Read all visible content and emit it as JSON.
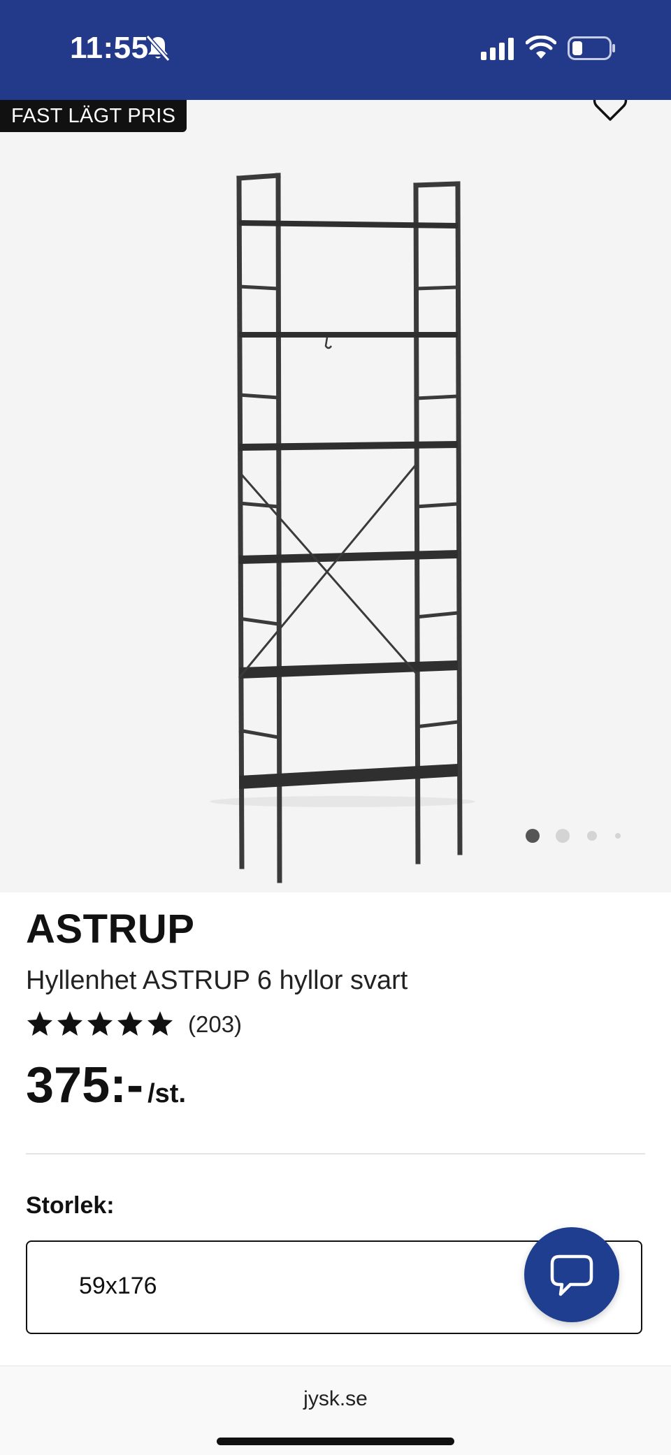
{
  "status_bar": {
    "time": "11:55",
    "background": "#233a8b",
    "icons": [
      "bell-muted-icon",
      "signal-icon",
      "wifi-icon",
      "battery-icon"
    ]
  },
  "gallery": {
    "badge": "FAST LÄGT PRIS",
    "favorite_icon": "heart-icon",
    "image": "shelf-product-image",
    "dots_count": 4,
    "active_dot": 1
  },
  "product": {
    "brand": "ASTRUP",
    "name": "Hyllenhet ASTRUP 6 hyllor svart",
    "rating_stars": 5,
    "review_count": "(203)",
    "price": "375:-",
    "price_unit": "/st."
  },
  "size": {
    "label": "Storlek:",
    "value": "59x176"
  },
  "chat": {
    "icon": "chat-bubble-icon",
    "color": "#1f3e8f"
  },
  "browser": {
    "url": "jysk.se"
  }
}
